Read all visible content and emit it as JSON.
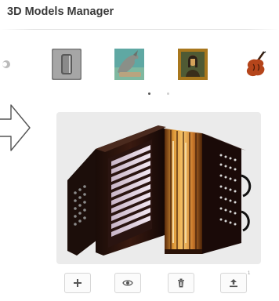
{
  "app": {
    "title": "3D Models Manager"
  },
  "carousel": {
    "thumbnails": [
      {
        "name": "prev-partial",
        "icon": "model-thumb-icon"
      },
      {
        "name": "phone",
        "icon": "phone-model-icon"
      },
      {
        "name": "dolphin",
        "icon": "dolphin-model-icon"
      },
      {
        "name": "mona-lisa",
        "icon": "painting-model-icon"
      },
      {
        "name": "violin",
        "icon": "violin-model-icon"
      }
    ],
    "active_page": 1,
    "page_count": 2
  },
  "preview": {
    "model": "accordion",
    "icon": "accordion-model-icon"
  },
  "toolbar": {
    "buttons": [
      {
        "name": "add",
        "icon": "plus-icon"
      },
      {
        "name": "view",
        "icon": "eye-icon"
      },
      {
        "name": "delete",
        "icon": "trash-icon"
      },
      {
        "name": "upload",
        "icon": "upload-icon"
      }
    ],
    "corner_mark": "1"
  },
  "colors": {
    "accent": "#3a3a3a",
    "preview_bg": "#ebebeb",
    "border": "#d6d6d6"
  }
}
